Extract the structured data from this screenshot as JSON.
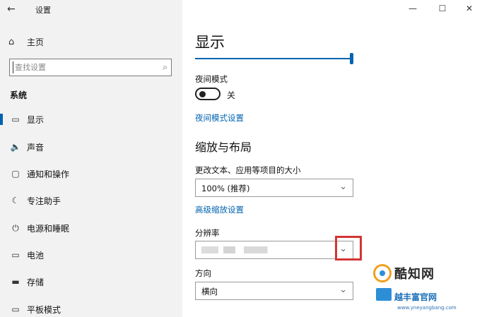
{
  "window": {
    "title": "设置",
    "back_glyph": "←",
    "minimize_glyph": "—",
    "maximize_glyph": "☐",
    "close_glyph": "✕"
  },
  "sidebar": {
    "home": {
      "label": "主页",
      "icon": "home-icon",
      "glyph": "⌂"
    },
    "search": {
      "placeholder": "查找设置",
      "icon_glyph": "⌕"
    },
    "section_heading": "系统",
    "items": [
      {
        "label": "显示",
        "icon": "monitor-icon",
        "glyph": "▭",
        "selected": true
      },
      {
        "label": "声音",
        "icon": "speaker-icon",
        "glyph": "🔈",
        "selected": false
      },
      {
        "label": "通知和操作",
        "icon": "notification-icon",
        "glyph": "▢",
        "selected": false
      },
      {
        "label": "专注助手",
        "icon": "moon-icon",
        "glyph": "☾",
        "selected": false
      },
      {
        "label": "电源和睡眠",
        "icon": "power-icon",
        "glyph": "⏻",
        "selected": false
      },
      {
        "label": "电池",
        "icon": "battery-icon",
        "glyph": "▭",
        "selected": false
      },
      {
        "label": "存储",
        "icon": "storage-icon",
        "glyph": "▬",
        "selected": false
      },
      {
        "label": "平板模式",
        "icon": "tablet-icon",
        "glyph": "▭",
        "selected": false
      }
    ],
    "accent_color": "#0063b1"
  },
  "main": {
    "title": "显示",
    "brightness_slider_value_percent": 100,
    "night_light": {
      "label": "夜间模式",
      "state_label": "关",
      "on": false,
      "settings_link": "夜间模式设置"
    },
    "scale_layout": {
      "heading": "缩放与布局",
      "scale_label": "更改文本、应用等项目的大小",
      "scale_value": "100% (推荐)",
      "advanced_link": "高级缩放设置",
      "resolution_label": "分辨率",
      "orientation_label": "方向",
      "orientation_value": "横向"
    },
    "highlight_color": "#d23535",
    "chevron_glyph": "⌄"
  },
  "watermark": {
    "brand": "酷知网",
    "sub": "越丰富官网",
    "url": "www.yneyangbang.com"
  }
}
